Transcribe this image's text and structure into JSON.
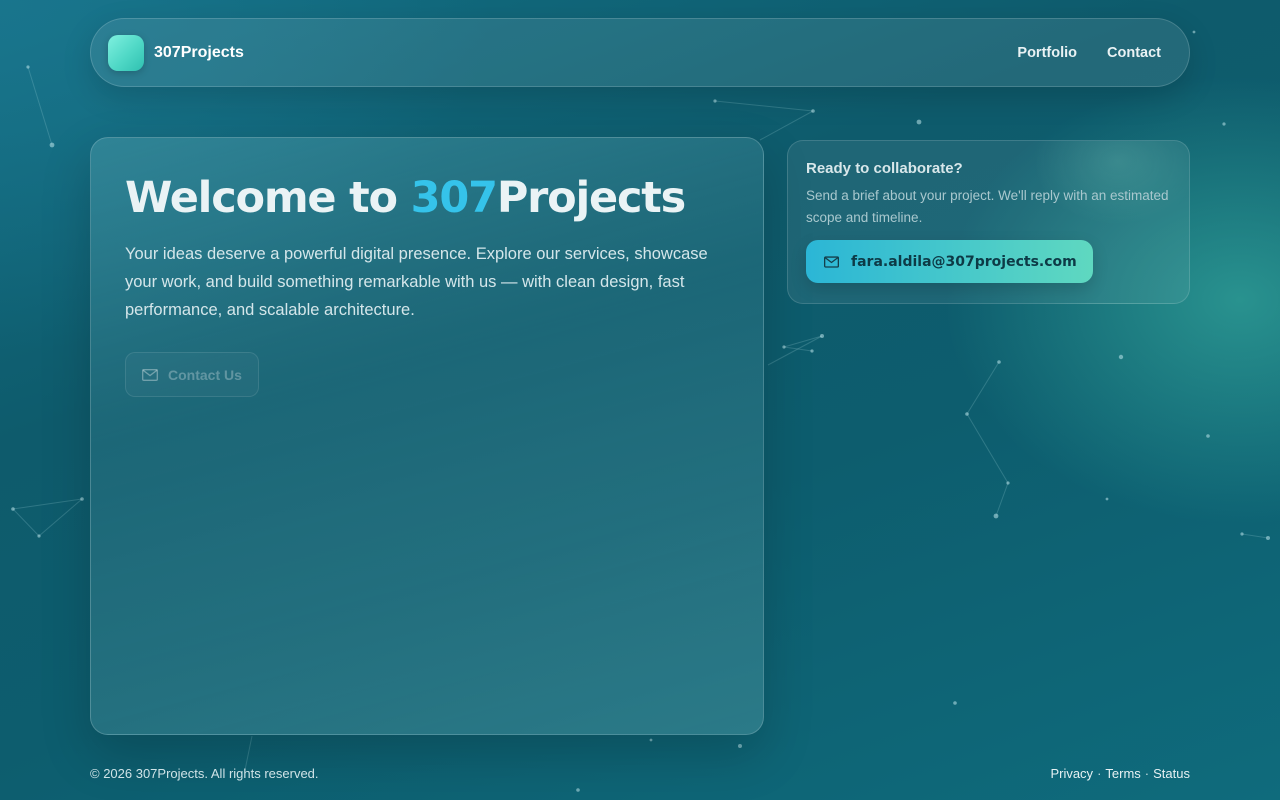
{
  "nav": {
    "brand": "307Projects",
    "links": [
      "Portfolio",
      "Contact"
    ]
  },
  "hero": {
    "title_prefix": "Welcome to ",
    "title_accent": "307",
    "title_suffix": "Projects",
    "description": "Your ideas deserve a powerful digital presence. Explore our services, showcase your work, and build something remarkable with us — with clean design, fast performance, and scalable architecture.",
    "button_label": "Contact Us",
    "button_icon": "mail-icon"
  },
  "collab": {
    "title": "Ready to collaborate?",
    "description": "Send a brief about your project. We'll reply with an estimated scope and timeline.",
    "email_label": "fara.aldila@307projects.com",
    "email_icon": "mail-icon"
  },
  "footer": {
    "copyright": "© 2026 307Projects. All rights reserved.",
    "links": [
      "Privacy",
      "Terms",
      "Status"
    ],
    "separator": "·"
  },
  "colors": {
    "accent": "#35c3ea",
    "email_button_start": "#2bb6d6",
    "email_button_end": "#5fd8c0",
    "background": "#0e5b6c"
  }
}
